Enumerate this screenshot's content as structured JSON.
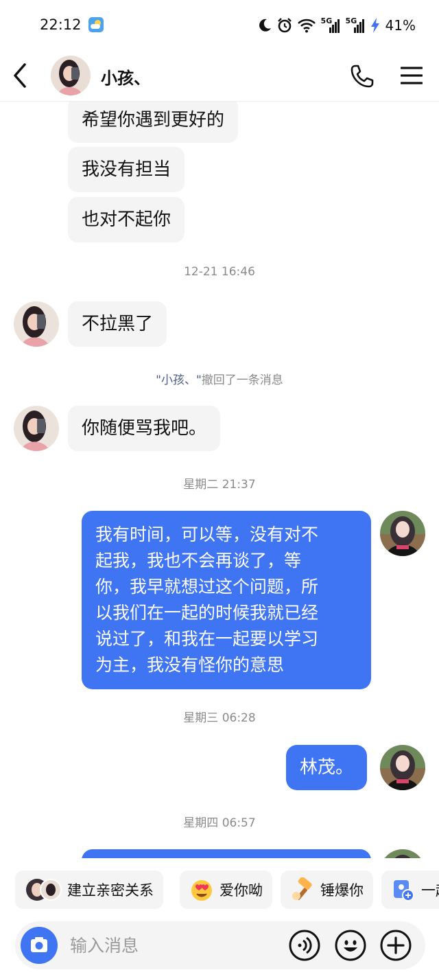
{
  "status_bar": {
    "time": "22:12",
    "battery": "41%",
    "network_1": "5G",
    "network_2": "5G"
  },
  "header": {
    "contact_name": "小孩、",
    "icons": [
      "back-icon",
      "phone-icon",
      "menu-icon"
    ]
  },
  "messages": [
    {
      "type": "incoming",
      "text": "希望你遇到更好的"
    },
    {
      "type": "incoming",
      "text": "我没有担当"
    },
    {
      "type": "incoming",
      "text": "也对不起你"
    },
    {
      "type": "timestamp",
      "text": "12-21 16:46"
    },
    {
      "type": "incoming",
      "text": "不拉黑了"
    },
    {
      "type": "recall",
      "who": "\"小孩、\"",
      "text": "撤回了一条消息"
    },
    {
      "type": "incoming",
      "text": "你随便骂我吧。"
    },
    {
      "type": "timestamp",
      "text": "星期二 21:37"
    },
    {
      "type": "outgoing",
      "lines": [
        "我有时间，可以等，没有对不",
        "起我，我也不会再谈了，等",
        "你，我早就想过这个问题，所",
        "以我们在一起的时候我就已经",
        "说过了，和我在一起要以学习",
        "为主，我没有怪你的意思"
      ]
    },
    {
      "type": "timestamp",
      "text": "星期三 06:28"
    },
    {
      "type": "outgoing",
      "text": "林茂。"
    },
    {
      "type": "timestamp",
      "text": "星期四 06:57"
    }
  ],
  "quick_actions": [
    {
      "label": "建立亲密关系",
      "icon": "couple-avatar-icon"
    },
    {
      "label": "爱你呦",
      "icon": "heart-eyes-emoji-icon"
    },
    {
      "label": "锤爆你",
      "icon": "hammer-icon"
    },
    {
      "label": "一起",
      "icon": "profile-card-icon"
    }
  ],
  "input": {
    "placeholder": "输入消息"
  },
  "colors": {
    "accent": "#3f74f2",
    "bubble_in": "#f4f4f5",
    "timestamp": "#8a8a8a"
  }
}
